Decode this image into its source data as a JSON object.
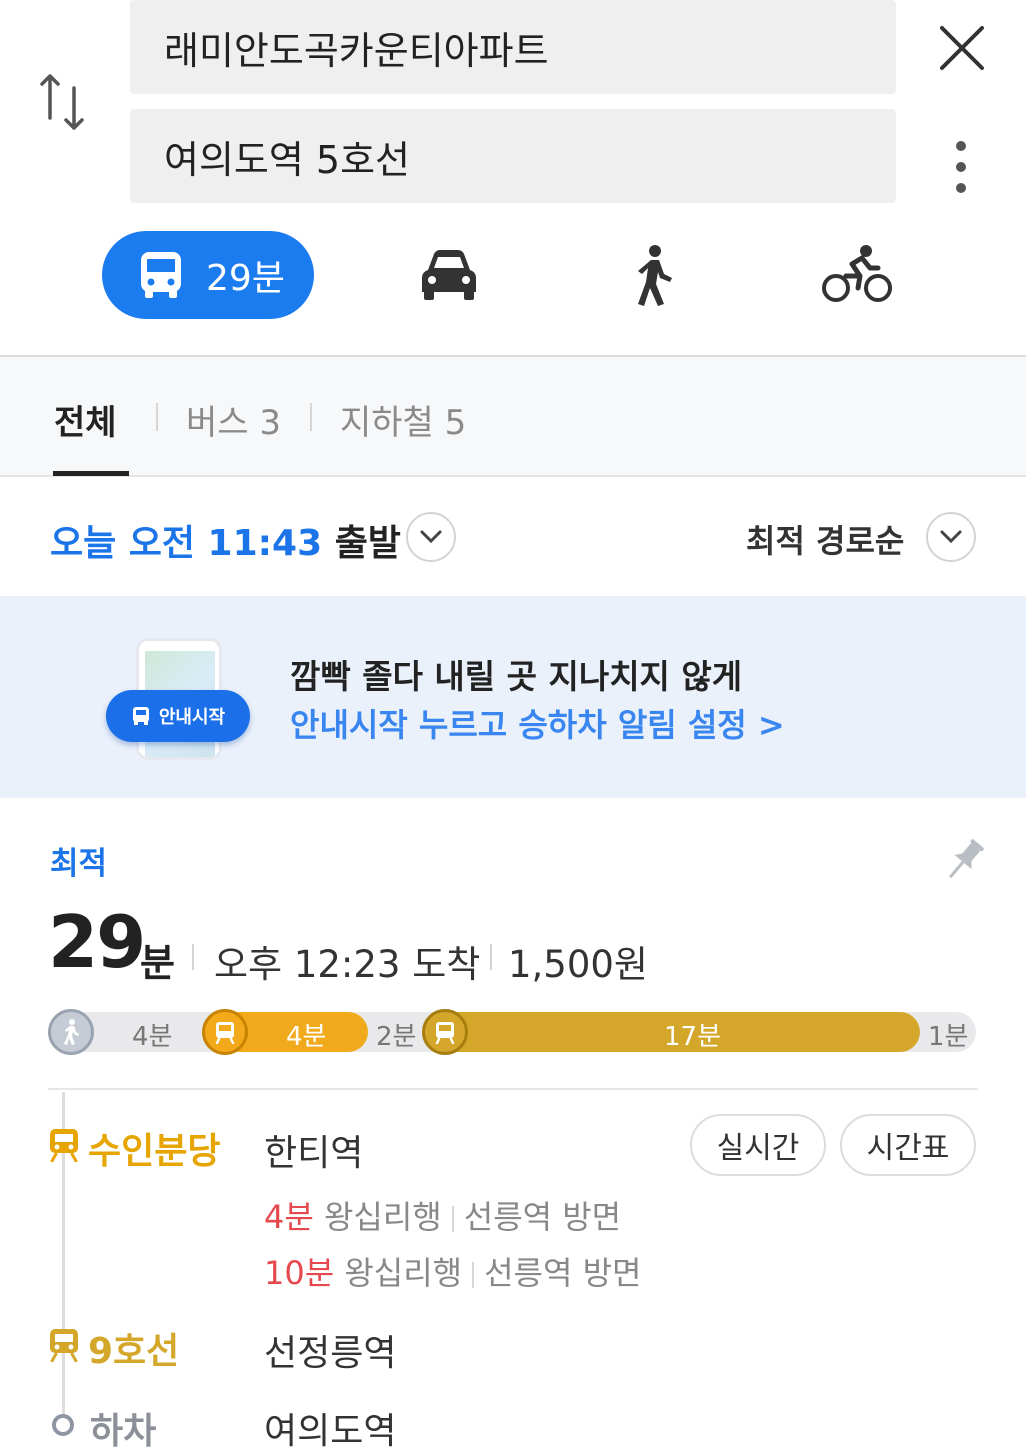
{
  "search": {
    "origin": "래미안도곡카운티아파트",
    "destination": "여의도역 5호선"
  },
  "modes": {
    "transit_time": "29분",
    "items": [
      "transit",
      "car",
      "walk",
      "bike"
    ]
  },
  "tabs": [
    {
      "label": "전체",
      "active": true
    },
    {
      "label": "버스 3",
      "active": false
    },
    {
      "label": "지하철 5",
      "active": false
    }
  ],
  "departure": {
    "time_label": "오늘 오전 11:43",
    "suffix": "출발",
    "sort_label": "최적 경로순"
  },
  "banner": {
    "pill_label": "안내시작",
    "line1": "깜빡 졸다 내릴 곳 지나치지 않게",
    "line2": "안내시작 누르고 승하차 알림 설정 >"
  },
  "route": {
    "badge": "최적",
    "total_minutes": "29",
    "minutes_unit": "분",
    "arrival": "오후 12:23 도착",
    "fare": "1,500원",
    "segments": {
      "walk1": "4분",
      "bus": "4분",
      "walk2": "2분",
      "subway": "17분",
      "walk3": "1분"
    },
    "steps": [
      {
        "line": "수인분당",
        "station": "한티역",
        "buttons": [
          "실시간",
          "시간표"
        ],
        "arrivals": [
          {
            "time": "4분",
            "dest": "왕십리행",
            "direction": "선릉역 방면"
          },
          {
            "time": "10분",
            "dest": "왕십리행",
            "direction": "선릉역 방면"
          }
        ]
      },
      {
        "line": "9호선",
        "station": "선정릉역"
      },
      {
        "line": "하차",
        "station": "여의도역"
      }
    ]
  },
  "colors": {
    "accent": "#1b7cf0",
    "bundang": "#f0aa1c",
    "line9": "#d4a72b",
    "arrival_red": "#e5494e"
  }
}
